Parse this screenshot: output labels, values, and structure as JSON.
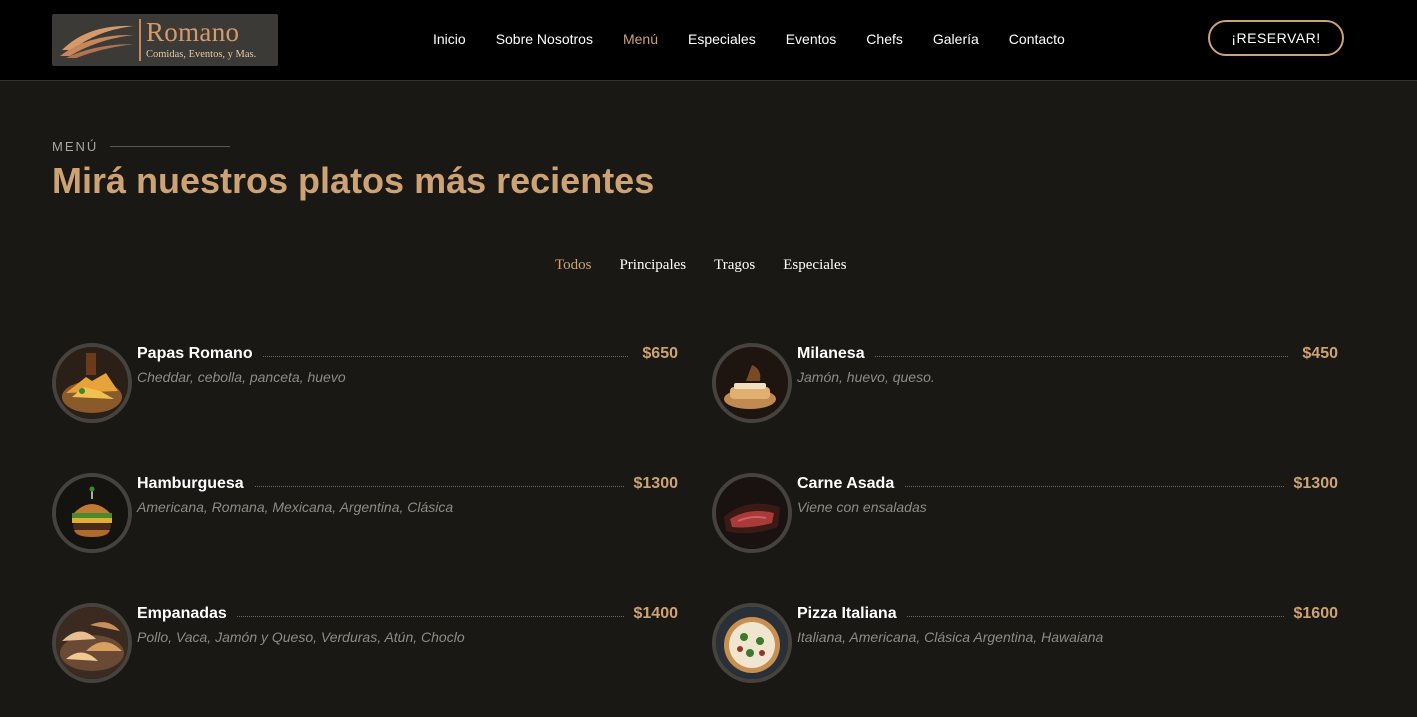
{
  "brand": {
    "name": "Romano",
    "tagline": "Comidas, Eventos, y Mas."
  },
  "nav": [
    {
      "label": "Inicio",
      "active": false
    },
    {
      "label": "Sobre Nosotros",
      "active": false
    },
    {
      "label": "Menú",
      "active": true
    },
    {
      "label": "Especiales",
      "active": false
    },
    {
      "label": "Eventos",
      "active": false
    },
    {
      "label": "Chefs",
      "active": false
    },
    {
      "label": "Galería",
      "active": false
    },
    {
      "label": "Contacto",
      "active": false
    }
  ],
  "reserve_label": "¡RESERVAR!",
  "section": {
    "kicker": "MENÚ",
    "title": "Mirá nuestros platos más recientes"
  },
  "filters": [
    {
      "label": "Todos",
      "active": true
    },
    {
      "label": "Principales",
      "active": false
    },
    {
      "label": "Tragos",
      "active": false
    },
    {
      "label": "Especiales",
      "active": false
    }
  ],
  "items": [
    {
      "name": "Papas Romano",
      "price": "$650",
      "desc": "Cheddar, cebolla, panceta, huevo",
      "photo": "fries-photo"
    },
    {
      "name": "Milanesa",
      "price": "$450",
      "desc": "Jamón, huevo, queso.",
      "photo": "milanesa-photo"
    },
    {
      "name": "Hamburguesa",
      "price": "$1300",
      "desc": "Americana, Romana, Mexicana, Argentina, Clásica",
      "photo": "burger-photo"
    },
    {
      "name": "Carne Asada",
      "price": "$1300",
      "desc": "Viene con ensaladas",
      "photo": "steak-photo"
    },
    {
      "name": "Empanadas",
      "price": "$1400",
      "desc": "Pollo, Vaca, Jamón y Queso, Verduras, Atún, Choclo",
      "photo": "empanadas-photo"
    },
    {
      "name": "Pizza Italiana",
      "price": "$1600",
      "desc": "Italiana, Americana, Clásica Argentina, Hawaiana",
      "photo": "pizza-photo"
    }
  ],
  "colors": {
    "accent": "#cda274",
    "background": "#1a1814",
    "header": "#000000"
  }
}
